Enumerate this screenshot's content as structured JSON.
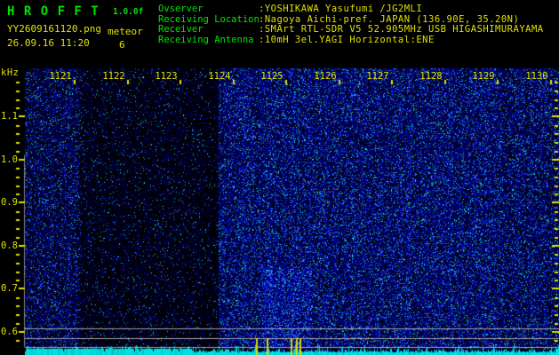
{
  "header": {
    "title": "H R O F F T",
    "version": "1.0.0f",
    "filename": "YY2609161120.png",
    "mode_label": "meteor",
    "datetime": "26.09.16 11:20",
    "meteor_count": "6",
    "info_rows": [
      {
        "key": "Ovserver",
        "value": ":YOSHIKAWA Yasufumi /JG2MLI"
      },
      {
        "key": "Receiving Location",
        "value": ":Nagoya Aichi-pref. JAPAN (136.90E, 35.20N)"
      },
      {
        "key": "Receiver",
        "value": ":SMArt RTL-SDR V5 52.905MHz USB HIGASHIMURAYAMA"
      },
      {
        "key": "Receiving Antenna",
        "value": ":10mH 3el.YAGI Horizontal:ENE"
      }
    ]
  },
  "chart_data": {
    "type": "heatmap",
    "title": "",
    "description": "10-minute radio meteor echo spectrogram (HROFFT). Blue noise intensity vs time and audio frequency.",
    "x_axis": {
      "tick_labels": [
        "1121",
        "1122",
        "1123",
        "1124",
        "1125",
        "1126",
        "1127",
        "1128",
        "1129",
        "1130"
      ],
      "unit": "time HHMM",
      "range": [
        "11:20",
        "11:30"
      ]
    },
    "y_axis": {
      "unit_label": "kHz",
      "tick_labels": [
        "1.1",
        "1.0",
        "0.9",
        "0.8",
        "0.7",
        "0.6"
      ],
      "range": [
        0.56,
        1.18
      ],
      "minor_step_khz": 0.02
    },
    "intensity_bands": [
      {
        "minutes": "1121",
        "level": "medium"
      },
      {
        "minutes": "1122-1124",
        "level": "low (quiet band)"
      },
      {
        "minutes": "1125-1129",
        "level": "high"
      },
      {
        "minutes": "1130",
        "level": "medium-high"
      }
    ],
    "horizontal_reference_lines_khz": [
      0.61,
      0.59,
      0.56
    ],
    "signal_level_strip": {
      "saturated_until": "approx 11:23.1",
      "echo_marker_times": [
        "11:24.4",
        "11:24.6",
        "11:25.0",
        "11:25.1",
        "11:25.2"
      ]
    },
    "legend_position": "none",
    "grid": false
  },
  "colors": {
    "background": "#000000",
    "text_green": "#00e400",
    "text_yellow": "#e0e000",
    "noise_blue_dark": "#000080",
    "noise_blue_bright": "#2244ee",
    "noise_cyan": "#00cccc",
    "level_strip_cyan": "#00e2e2",
    "reference_line_gray": "#b4b4b4",
    "echo_marker_yellow": "#d8d800"
  }
}
